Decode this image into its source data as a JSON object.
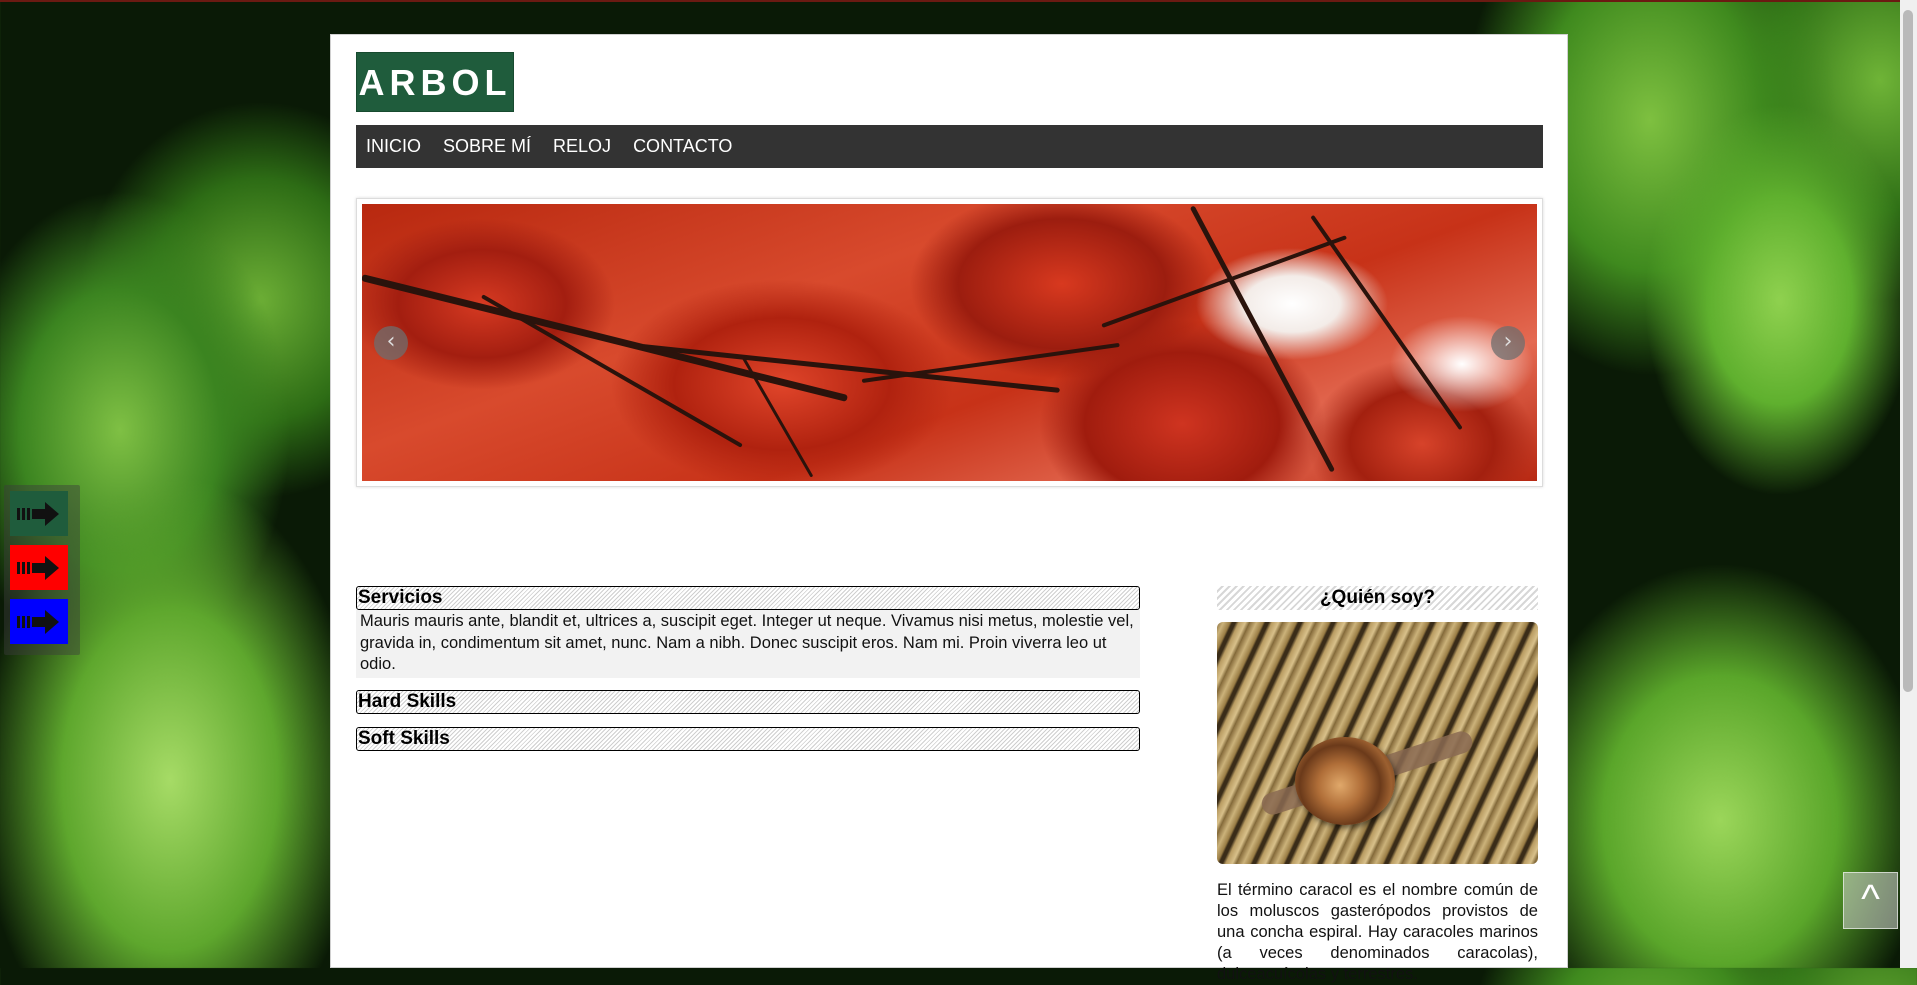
{
  "logo": {
    "text": "ARBOL"
  },
  "nav": {
    "items": [
      {
        "label": "INICIO"
      },
      {
        "label": "SOBRE MÍ"
      },
      {
        "label": "RELOJ"
      },
      {
        "label": "CONTACTO"
      }
    ]
  },
  "slider": {
    "prev_icon": "chevron-left-icon",
    "next_icon": "chevron-right-icon"
  },
  "accordion": {
    "sections": [
      {
        "title": "Servicios",
        "expanded": true,
        "body": "Mauris mauris ante, blandit et, ultrices a, suscipit eget. Integer ut neque. Vivamus nisi metus, molestie vel, gravida in, condimentum sit amet, nunc. Nam a nibh. Donec suscipit eros. Nam mi. Proin viverra leo ut odio."
      },
      {
        "title": "Hard Skills",
        "expanded": false
      },
      {
        "title": "Soft Skills",
        "expanded": false
      }
    ]
  },
  "sidebar": {
    "title": "¿Quién soy?",
    "text": "El término caracol es el nombre común de los moluscos gasterópodos provistos de una concha espiral. Hay caracoles marinos (a veces denominados caracolas), dulceacuícolas y terrestres."
  },
  "theme_buttons": [
    {
      "icon": "arrow-right-icon",
      "color": "#1f5c3c"
    },
    {
      "icon": "arrow-right-icon",
      "color": "#ff0000"
    },
    {
      "icon": "arrow-right-icon",
      "color": "#0000ff"
    }
  ],
  "to_top": {
    "label": "^"
  }
}
